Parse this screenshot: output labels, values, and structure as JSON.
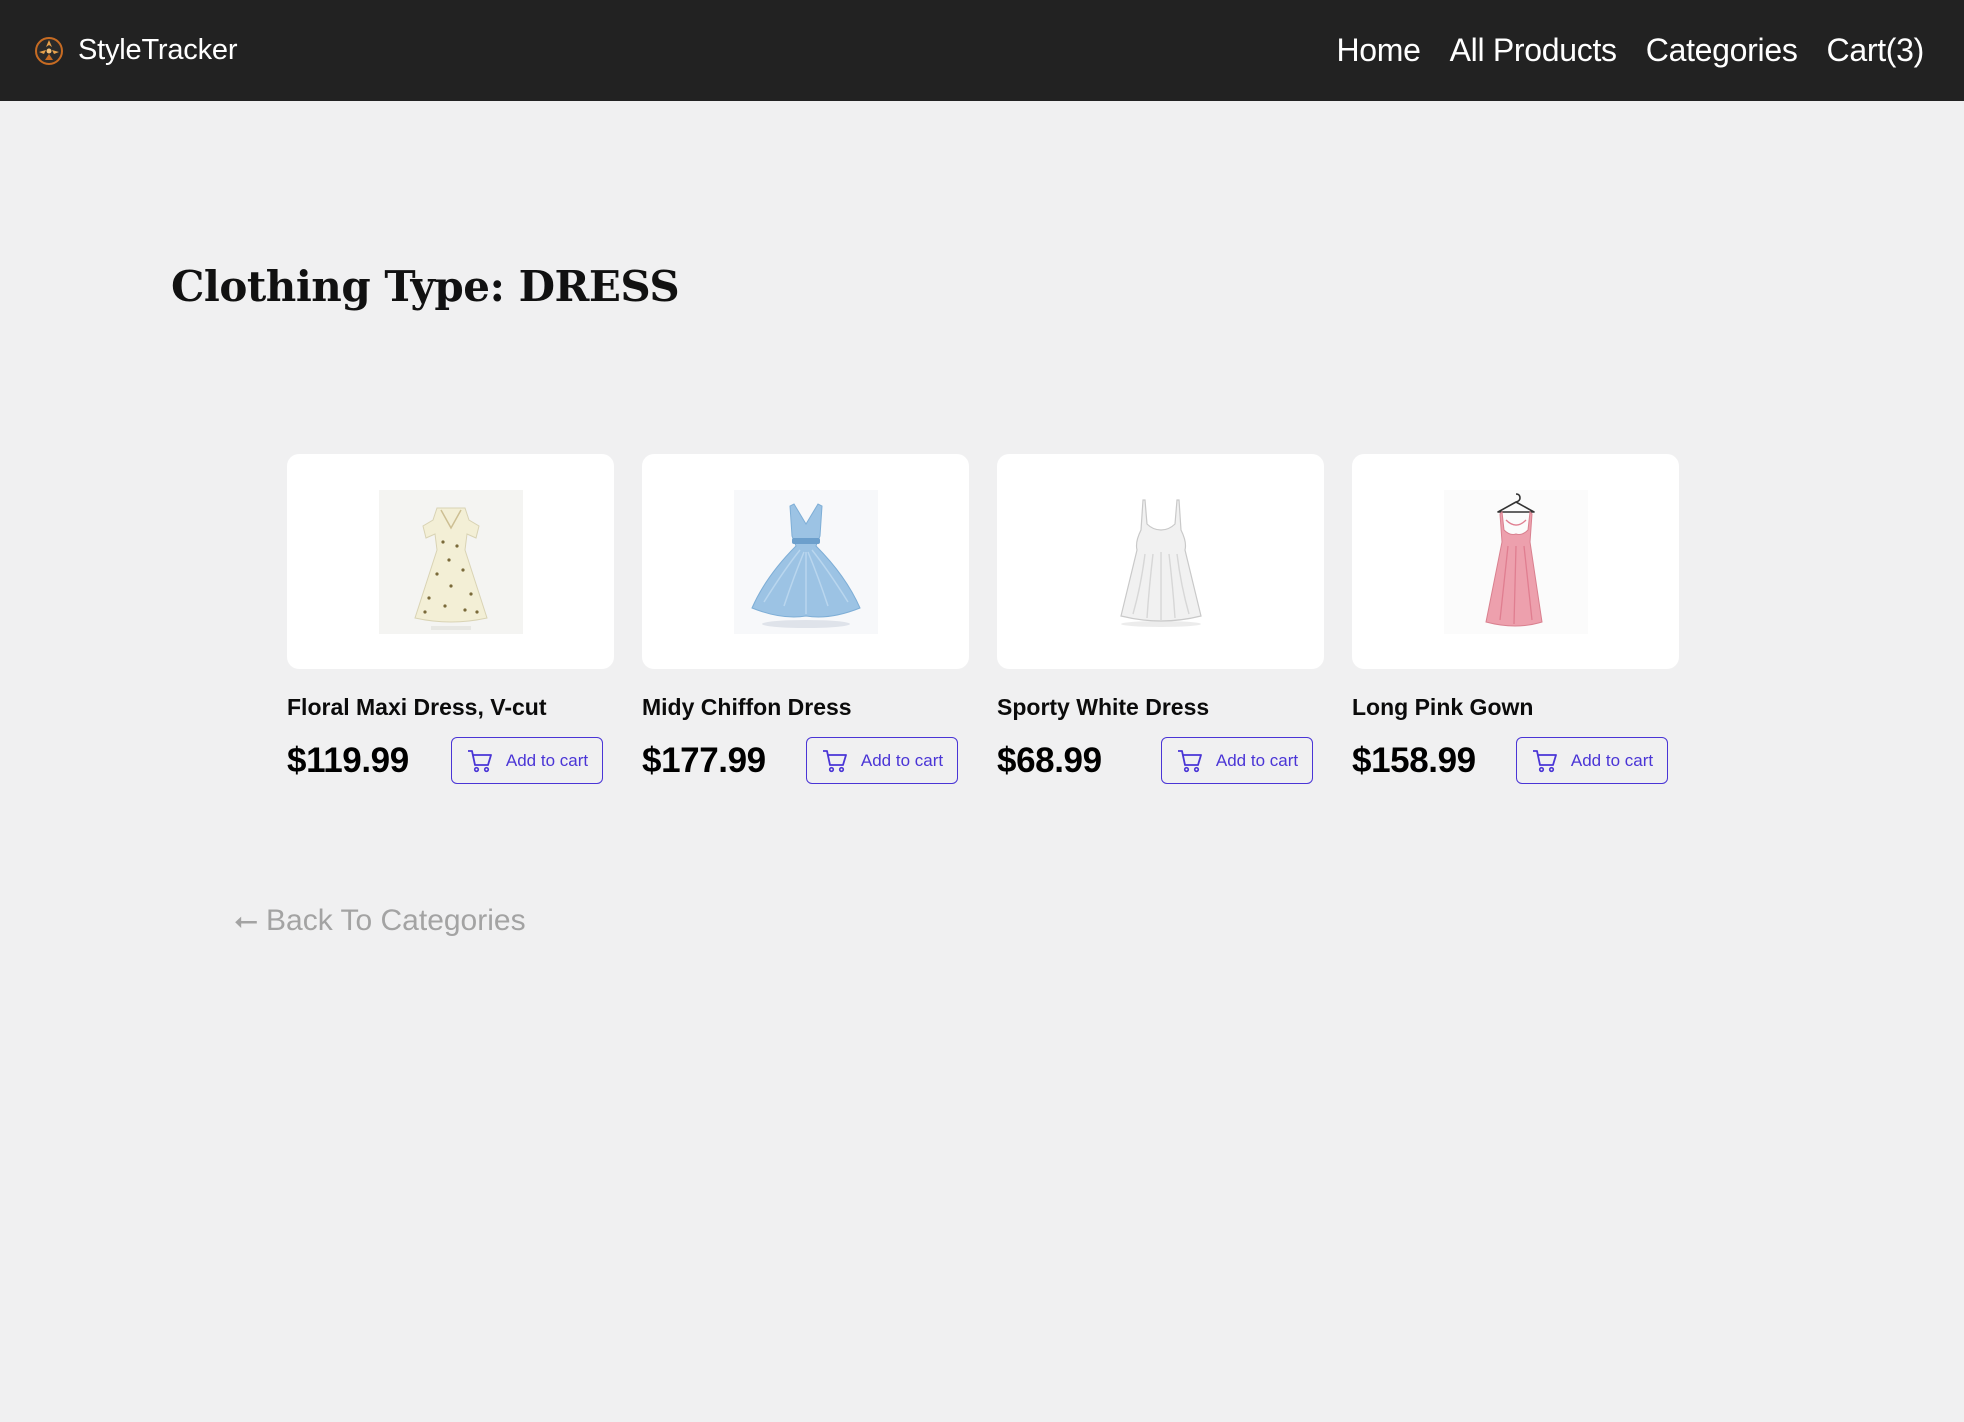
{
  "nav": {
    "brand": "StyleTracker",
    "links": [
      {
        "label": "Home"
      },
      {
        "label": "All Products"
      },
      {
        "label": "Categories"
      },
      {
        "label": "Cart(3)"
      }
    ]
  },
  "heading": {
    "prefix": "Clothing Type: ",
    "type": "DRESS"
  },
  "products": [
    {
      "name": "Floral Maxi Dress, V-cut",
      "price": "$119.99",
      "cta": "Add to cart",
      "image": "floral-cream-dress"
    },
    {
      "name": "Midy Chiffon Dress",
      "price": "$177.99",
      "cta": "Add to cart",
      "image": "blue-chiffon-dress"
    },
    {
      "name": "Sporty White Dress",
      "price": "$68.99",
      "cta": "Add to cart",
      "image": "white-slip-dress"
    },
    {
      "name": "Long Pink Gown",
      "price": "$158.99",
      "cta": "Add to cart",
      "image": "pink-gown-on-hanger"
    }
  ],
  "back": {
    "arrow": "⭠",
    "label": "Back To Categories"
  },
  "colors": {
    "navbar": "#222222",
    "page_bg": "#f0f0f1",
    "accent": "#4a35d6",
    "muted_text": "#a3a3a3"
  }
}
